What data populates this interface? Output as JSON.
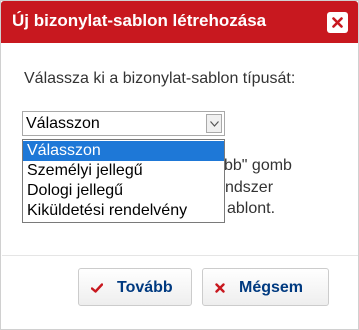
{
  "dialog": {
    "title": "Új bizonylat-sablon létrehozása",
    "prompt": "Válassza ki a bizonylat-sablon típusát:"
  },
  "select": {
    "value": "Válasszon",
    "options": [
      "Válasszon",
      "Személyi jellegű",
      "Dologi jellegű",
      "Kiküldetési rendelvény"
    ],
    "selected_index": 0
  },
  "obscured_text": {
    "line1": "bb\" gomb",
    "line2": "ndszer",
    "line3": "ablont."
  },
  "buttons": {
    "next_label": "Tovább",
    "cancel_label": "Mégsem"
  },
  "icons": {
    "close": "close-icon",
    "select_arrow": "chevron-down-icon",
    "next": "check-icon",
    "cancel": "x-icon"
  },
  "colors": {
    "titlebar": "#c8181f",
    "accent_check": "#c8181f",
    "accent_cross": "#c8181f",
    "button_text": "#003a80",
    "highlight": "#1e78d7"
  }
}
